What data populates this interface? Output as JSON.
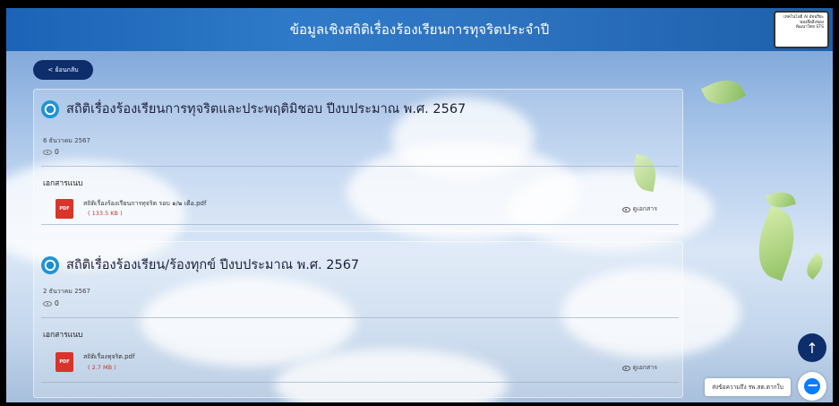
{
  "header": {
    "title": "ข้อมูลเชิงสถิติเรื่องร้องเรียนการทุจริตประจำปี"
  },
  "badge": {
    "lines": [
      "เทคโนโลยี AI อัจฉริยะ",
      "ฟองสื่อสิ่งของ",
      "พัฒนาโดย STS"
    ]
  },
  "back_button": {
    "label": "< ย้อนกลับ"
  },
  "cards": [
    {
      "title": "สถิติเรื่องร้องเรียนการทุจริตและประพฤติมิชอบ ปีงบประมาณ พ.ศ. 2567",
      "date": "6 ธันวาคม 2567",
      "views": "0",
      "attachments_label": "เอกสารแนบ",
      "files": [
        {
          "name": "สถิติเรื่องร้องเรียนการทุจริต รอบ ๑/๒ เดือ.pdf",
          "size": "( 133.5 KB )",
          "icon_label": "PDF",
          "view_label": "ดูเอกสาร"
        }
      ]
    },
    {
      "title": "สถิติเรื่องร้องเรียน/ร้องทุกข์ ปีงบประมาณ พ.ศ. 2567",
      "date": "2 ธันวาคม 2567",
      "views": "0",
      "attachments_label": "เอกสารแนบ",
      "files": [
        {
          "name": "สถิติเรื่องทุจริต.pdf",
          "size": "( 2.7 MB )",
          "icon_label": "PDF",
          "view_label": "ดูเอกสาร"
        }
      ]
    }
  ],
  "floating": {
    "scroll_top_icon": "↑",
    "chat_label": "ส่งข้อความถึง รพ.สต.ตากใบ"
  },
  "colors": {
    "header": "#2a6fbe",
    "button_dark": "#0d2d6b",
    "pdf_red": "#d9342b",
    "file_size_red": "#c0392b",
    "messenger_blue": "#0a7cff"
  }
}
